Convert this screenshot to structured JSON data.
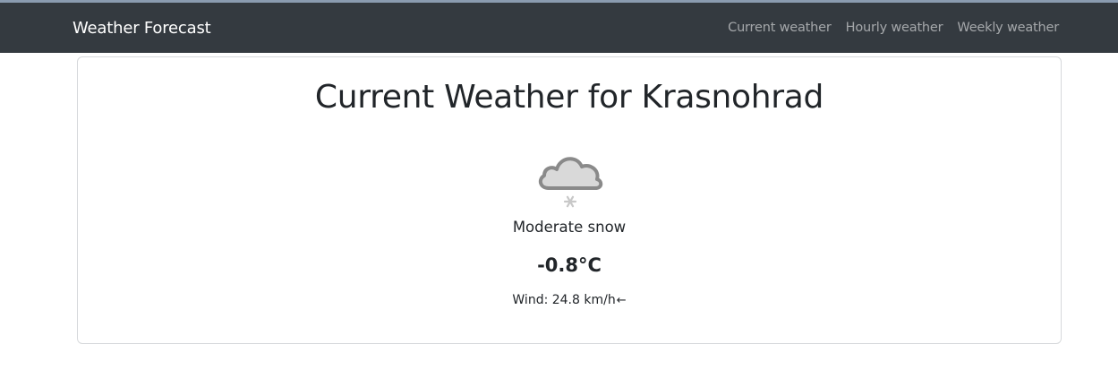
{
  "navbar": {
    "brand": "Weather Forecast",
    "links": [
      {
        "label": "Current weather"
      },
      {
        "label": "Hourly weather"
      },
      {
        "label": "Weekly weather"
      }
    ],
    "background_color": "#343a40"
  },
  "card": {
    "title": "Current Weather for Krasnohrad",
    "icon": "cloud-snow-icon",
    "condition": "Moderate snow",
    "temperature": "-0.8°C",
    "wind_label": "Wind: 24.8 km/h",
    "wind_arrow": "←"
  }
}
